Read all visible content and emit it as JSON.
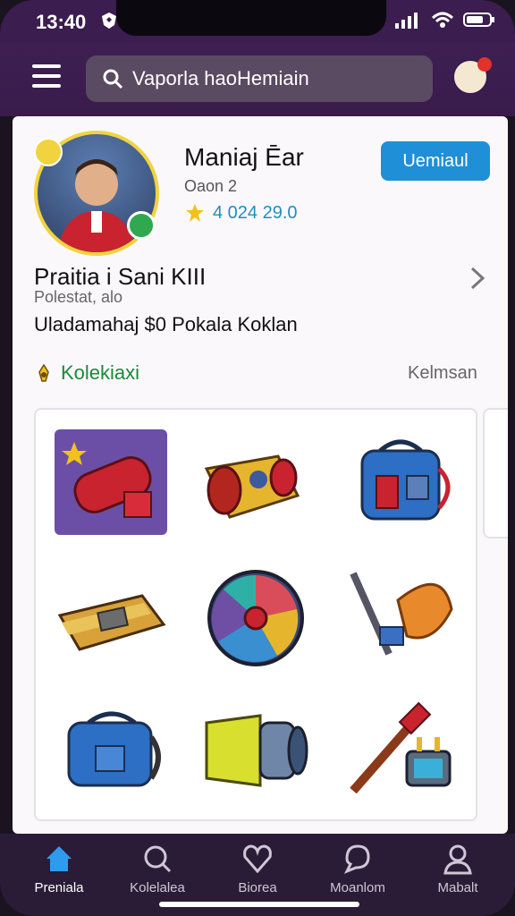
{
  "status": {
    "time": "13:40",
    "icons": [
      "shield-icon",
      "signal-icon",
      "wifi-icon",
      "battery-icon"
    ]
  },
  "header": {
    "search_value": "Vaporla haoHemiain",
    "search_placeholder": "Vaporla haoHemiain"
  },
  "profile": {
    "name": "Maniaj Ēar",
    "subtitle": "Oaon 2",
    "stat": "4 024 29.0",
    "primary_button": "Uemiaul"
  },
  "section": {
    "title": "Praitia i  Sani KIII",
    "subtitle": "Polestat, alo",
    "description": "Uladamahaj $0 Pokala Koklan"
  },
  "collection": {
    "title": "Kolekiaxi",
    "link": "Kelmsan",
    "items": [
      {
        "icon": "fire-extinguisher-icon"
      },
      {
        "icon": "cannon-icon"
      },
      {
        "icon": "backpack-icon"
      },
      {
        "icon": "wallet-icon"
      },
      {
        "icon": "shield-wheel-icon"
      },
      {
        "icon": "hammer-icon"
      },
      {
        "icon": "blue-backpack-icon"
      },
      {
        "icon": "horn-icon"
      },
      {
        "icon": "tools-icon"
      }
    ]
  },
  "nav": {
    "items": [
      {
        "label": "Preniala",
        "icon": "home-icon",
        "active": true
      },
      {
        "label": "Kolelalea",
        "icon": "search-icon",
        "active": false
      },
      {
        "label": "Biorea",
        "icon": "heart-icon",
        "active": false
      },
      {
        "label": "Moanlom",
        "icon": "chat-icon",
        "active": false
      },
      {
        "label": "Mabalt",
        "icon": "user-icon",
        "active": false
      }
    ]
  },
  "colors": {
    "header_bg": "#3e1f52",
    "primary": "#1f8fd8",
    "accent_green": "#1a8a3a",
    "nav_active": "#2f9bef"
  }
}
